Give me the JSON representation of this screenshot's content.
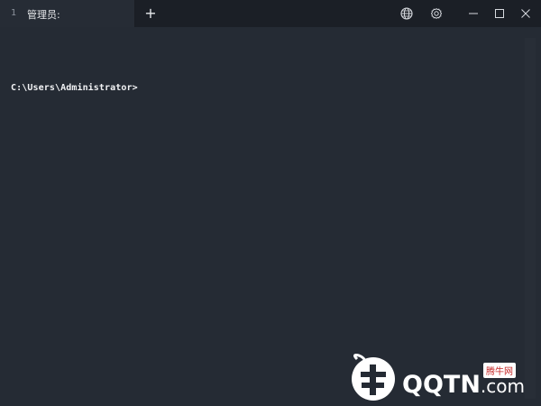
{
  "tab": {
    "index": "1",
    "title": "管理员:"
  },
  "toolbar": {
    "new_tab_label": "+",
    "globe_icon": "globe-icon",
    "settings_icon": "gear-icon"
  },
  "window_controls": {
    "minimize_icon": "minimize-icon",
    "maximize_icon": "maximize-icon",
    "close_icon": "close-icon"
  },
  "terminal": {
    "prompt": "C:\\Users\\Administrator>"
  },
  "watermark": {
    "brand": "QQTN",
    "domain_suffix": ".com",
    "badge": "腾牛网"
  },
  "colors": {
    "background": "#242a33",
    "titlebar": "#1b1f26",
    "text": "#f2f3f5"
  }
}
